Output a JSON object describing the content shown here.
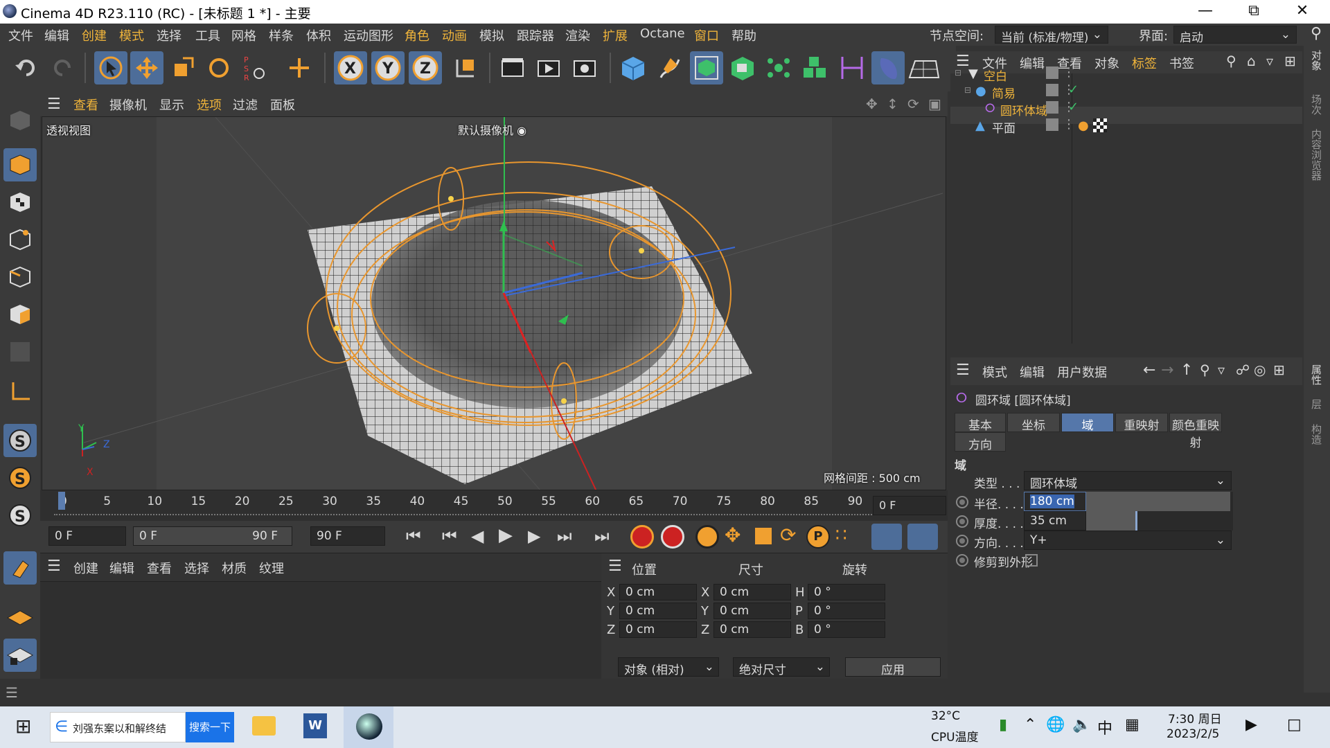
{
  "title": {
    "text": "Cinema 4D R23.110 (RC) - [未标题 1 *] - 主要"
  },
  "menu": {
    "items": [
      "文件",
      "编辑",
      "创建",
      "模式",
      "选择",
      "工具",
      "网格",
      "样条",
      "体积",
      "运动图形",
      "角色",
      "动画",
      "模拟",
      "跟踪器",
      "渲染",
      "扩展",
      "Octane",
      "窗口",
      "帮助"
    ],
    "node_space_label": "节点空间:",
    "node_space_value": "当前 (标准/物理)",
    "layout_label": "界面:",
    "layout_value": "启动"
  },
  "viewport": {
    "menu": [
      "查看",
      "摄像机",
      "显示",
      "选项",
      "过滤",
      "面板"
    ],
    "view_name": "透视视图",
    "camera_name": "默认摄像机",
    "grid_spacing": "网格间距 : 500 cm",
    "axis_x": "X",
    "axis_y": "Y",
    "axis_z": "Z"
  },
  "timeline": {
    "ticks": [
      "0",
      "5",
      "10",
      "15",
      "20",
      "25",
      "30",
      "35",
      "40",
      "45",
      "50",
      "55",
      "60",
      "65",
      "70",
      "75",
      "80",
      "85",
      "90"
    ],
    "current_frame": "0 F"
  },
  "transport": {
    "start": "0 F",
    "range_start": "0 F",
    "range_end": "90 F",
    "end": "90 F"
  },
  "material_manager": {
    "menu": [
      "创建",
      "编辑",
      "查看",
      "选择",
      "材质",
      "纹理"
    ]
  },
  "coord_manager": {
    "headers": [
      "位置",
      "尺寸",
      "旋转"
    ],
    "rows": [
      {
        "a": "X",
        "pos": "0 cm",
        "b": "X",
        "size": "0 cm",
        "c": "H",
        "rot": "0 °"
      },
      {
        "a": "Y",
        "pos": "0 cm",
        "b": "Y",
        "size": "0 cm",
        "c": "P",
        "rot": "0 °"
      },
      {
        "a": "Z",
        "pos": "0 cm",
        "b": "Z",
        "size": "0 cm",
        "c": "B",
        "rot": "0 °"
      }
    ],
    "mode1": "对象 (相对)",
    "mode2": "绝对尺寸",
    "apply": "应用"
  },
  "object_manager": {
    "menu": [
      "文件",
      "编辑",
      "查看",
      "对象",
      "标签",
      "书签"
    ],
    "objects": [
      {
        "name": "空白"
      },
      {
        "name": "简易"
      },
      {
        "name": "圆环体域"
      },
      {
        "name": "平面"
      }
    ]
  },
  "attribute_manager": {
    "menu": [
      "模式",
      "编辑",
      "用户数据"
    ],
    "object_title": "圆环域 [圆环体域]",
    "tabs": [
      "基本",
      "坐标",
      "域",
      "重映射",
      "颜色重映射",
      "方向"
    ],
    "section": "域",
    "type_label": "类型 . . . .",
    "type_value": "圆环体域",
    "radius_label": "半径. . . .",
    "radius_value": "180 cm",
    "radius_fill": 0.98,
    "thickness_label": "厚度. . . .",
    "thickness_value": "35 cm",
    "thickness_fill": 0.35,
    "direction_label": "方向. . . .",
    "direction_value": "Y+",
    "clip_label": "修剪到外形"
  },
  "right_strip": {
    "tabs": [
      "对象",
      "场次",
      "内容浏览器",
      "属性",
      "层",
      "构造"
    ]
  },
  "taskbar": {
    "search_text": "刘强东案以和解终结",
    "search_button": "搜索一下",
    "temp": "32°C",
    "temp_label": "CPU温度",
    "ime": "中",
    "time": "7:30 周日",
    "date": "2023/2/5"
  }
}
